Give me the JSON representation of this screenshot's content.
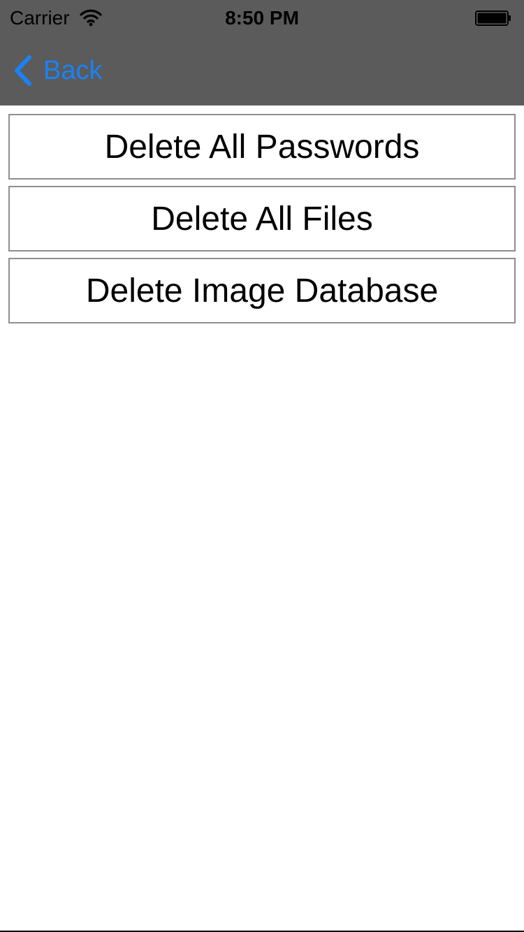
{
  "status_bar": {
    "carrier": "Carrier",
    "time": "8:50 PM",
    "wifi_icon": "wifi-icon",
    "battery_icon": "battery-icon"
  },
  "nav_bar": {
    "back_label": "Back",
    "back_icon": "chevron-left-icon",
    "background_color": "#5b5b5b",
    "accent_color": "#1a82f7"
  },
  "actions": [
    {
      "label": "Delete All Passwords"
    },
    {
      "label": "Delete All Files"
    },
    {
      "label": "Delete Image Database"
    }
  ]
}
